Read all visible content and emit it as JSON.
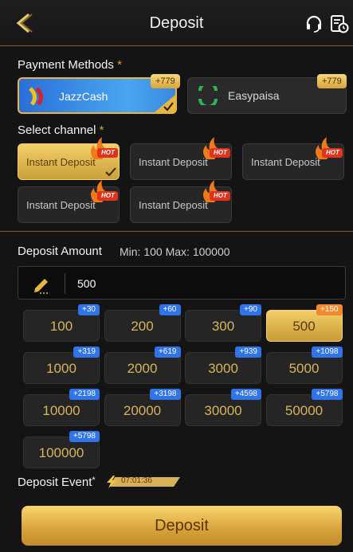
{
  "header": {
    "title": "Deposit"
  },
  "payment_methods": {
    "label": "Payment Methods",
    "required_mark": "*",
    "items": [
      {
        "name": "JazzCash",
        "bonus": "+779",
        "selected": true
      },
      {
        "name": "Easypaisa",
        "bonus": "+779",
        "selected": false
      }
    ]
  },
  "channels": {
    "label": "Select channel",
    "required_mark": "*",
    "hot_label": "HOT",
    "items": [
      {
        "label": "Instant Deposit",
        "selected": true
      },
      {
        "label": "Instant Deposit",
        "selected": false
      },
      {
        "label": "Instant Deposit",
        "selected": false
      },
      {
        "label": "Instant Deposit",
        "selected": false
      },
      {
        "label": "Instant Deposit",
        "selected": false
      }
    ]
  },
  "amount": {
    "label": "Deposit Amount",
    "limits": "Min: 100  Max: 100000",
    "value": "500"
  },
  "chips": [
    {
      "amount": "100",
      "bonus": "+30"
    },
    {
      "amount": "200",
      "bonus": "+60"
    },
    {
      "amount": "300",
      "bonus": "+90"
    },
    {
      "amount": "500",
      "bonus": "+150",
      "selected": true
    },
    {
      "amount": "1000",
      "bonus": "+319"
    },
    {
      "amount": "2000",
      "bonus": "+619"
    },
    {
      "amount": "3000",
      "bonus": "+939"
    },
    {
      "amount": "5000",
      "bonus": "+1098"
    },
    {
      "amount": "10000",
      "bonus": "+2198"
    },
    {
      "amount": "20000",
      "bonus": "+3198"
    },
    {
      "amount": "30000",
      "bonus": "+4598"
    },
    {
      "amount": "50000",
      "bonus": "+5798"
    },
    {
      "amount": "100000",
      "bonus": "+5798"
    }
  ],
  "event": {
    "label": "Deposit Event",
    "required_mark": "*",
    "timer": "07:01:36"
  },
  "submit": {
    "label": "Deposit"
  },
  "colors": {
    "accent_gold": "#e8b640",
    "bonus_blue": "#2f74e8",
    "bonus_orange": "#f08a30"
  }
}
